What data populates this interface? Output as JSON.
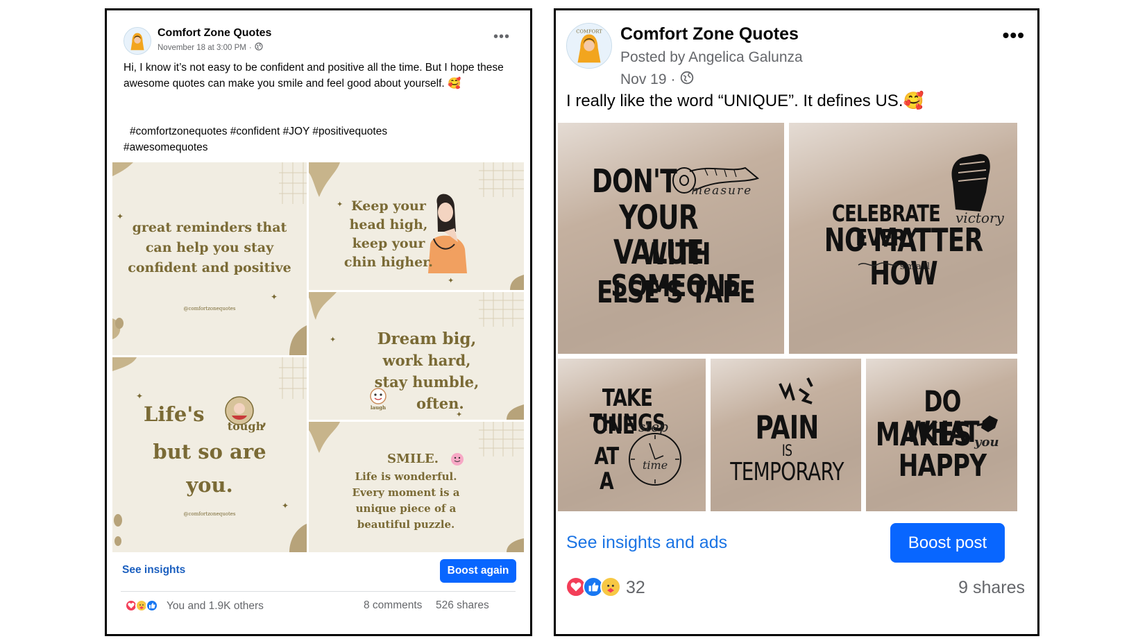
{
  "left_post": {
    "page_name": "Comfort Zone Quotes",
    "timestamp": "November 18 at 3:00 PM",
    "separator": "·",
    "caption": "Hi, I know it’s not easy to be confident and positive all the time. But I hope these awesome quotes can make you smile and feel good about yourself. 🥰",
    "hashtags_line1": "#comfortzonequotes #confident #JOY #positivequotes",
    "hashtags_line2": "#awesomequotes",
    "tiles": [
      {
        "text": "great reminders that can help you stay confident and positive",
        "handle": "@comfortzonequotes"
      },
      {
        "text": "Keep your head high, keep your chin higher."
      },
      {
        "text_part1": "Life's",
        "text_part2": "but so are you.",
        "sticker": "tough",
        "handle": "@comfortzonequotes"
      },
      {
        "text_line1": "Dream big,",
        "text_line2": "work hard,",
        "text_line3": "stay humble,",
        "text_line4": "often.",
        "sticker": "laugh"
      },
      {
        "title": "SMILE.",
        "body": "Life is wonderful. Every moment is a unique piece of a beautiful puzzle."
      }
    ],
    "insights_label": "See insights",
    "boost_label": "Boost again",
    "reactions_text": "You and 1.9K others",
    "comments_text": "8 comments",
    "shares_text": "526 shares",
    "more_label": "•••"
  },
  "right_post": {
    "page_name": "Comfort Zone Quotes",
    "posted_by": "Posted by Angelica Galunza",
    "date": "Nov 19",
    "separator": "·",
    "caption": "I really like the word “UNIQUE”. It defines US.🥰",
    "tiles": [
      {
        "line1": "DON'T",
        "script": "measure",
        "line2": "YOUR VALUE",
        "line3": "WITH SOMEONE",
        "line4": "ELSE'S TAPE"
      },
      {
        "line1": "CELEBRATE EVERY",
        "script": "victory",
        "line2": "NO MATTER HOW",
        "script2": "small"
      },
      {
        "line1": "TAKE THINGS",
        "line2": "ONE",
        "script": "step",
        "line3": "AT A",
        "script2": "time"
      },
      {
        "line1": "PAIN",
        "line2": "IS",
        "line3": "TEMPORARY"
      },
      {
        "line1": "DO WHAT",
        "line2": "MAKES",
        "script": "you",
        "line3": "HAPPY"
      }
    ],
    "insights_label": "See insights and ads",
    "boost_label": "Boost post",
    "reactions_count": "32",
    "shares_text": "9 shares",
    "more_label": "•••"
  },
  "colors": {
    "link_blue": "#1b74e4",
    "button_blue": "#0866ff",
    "tile_cream": "#f1ede2",
    "tile_olive_text": "#7a6a35",
    "tile_taupe": "#c4b09f",
    "secondary_text": "#65676b"
  }
}
